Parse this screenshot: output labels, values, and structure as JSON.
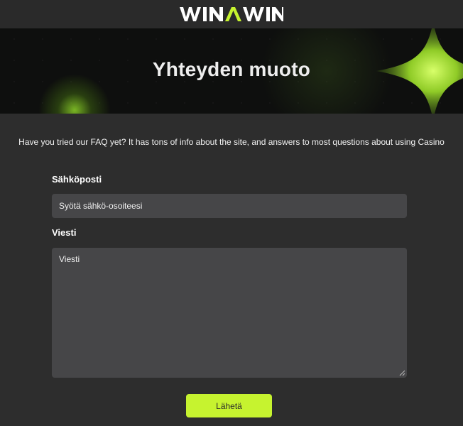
{
  "header": {
    "logo_text": "WINAWIN",
    "logo_icon": "winawin-logo",
    "accent_color": "#c6f32f"
  },
  "hero": {
    "title": "Yhteyden muoto"
  },
  "intro": {
    "faq_text": "Have you tried our FAQ yet? It has tons of info about the site, and answers to most questions about using Casino"
  },
  "form": {
    "email_label": "Sähköposti",
    "email_placeholder": "Syötä sähkö-osoiteesi",
    "email_value": "",
    "message_label": "Viesti",
    "message_placeholder": "Viesti",
    "message_value": "",
    "submit_label": "Lähetä"
  }
}
